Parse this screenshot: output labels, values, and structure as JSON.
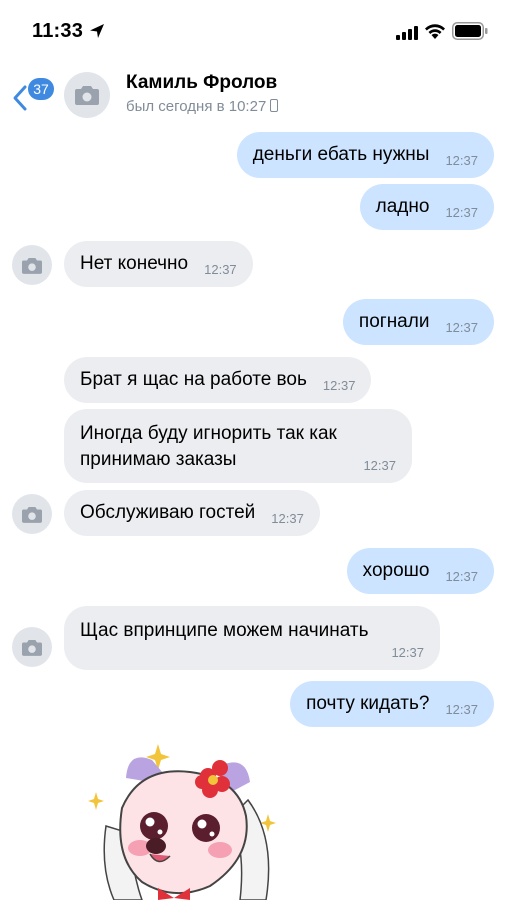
{
  "status_bar": {
    "time": "11:33",
    "icons": [
      "location-arrow-icon",
      "cellular-signal-icon",
      "wifi-icon",
      "battery-icon"
    ]
  },
  "header": {
    "back_badge": "37",
    "contact_name": "Камиль Фролов",
    "last_seen": "был сегодня в 10:27",
    "icons": [
      "back-arrow-icon",
      "camera-icon",
      "phone-icon"
    ]
  },
  "messages": [
    {
      "direction": "out",
      "text": "деньги ебать нужны",
      "time": "12:37"
    },
    {
      "direction": "out",
      "text": "ладно",
      "time": "12:37"
    },
    {
      "direction": "in",
      "text": "Нет конечно",
      "time": "12:37",
      "avatar": true
    },
    {
      "direction": "out",
      "text": "погнали",
      "time": "12:37"
    },
    {
      "direction": "in",
      "text": "Брат я щас на работе воь",
      "time": "12:37"
    },
    {
      "direction": "in",
      "text": "Иногда буду игнорить так как принимаю заказы",
      "time": "12:37"
    },
    {
      "direction": "in",
      "text": "Обслуживаю гостей",
      "time": "12:37",
      "avatar": true
    },
    {
      "direction": "out",
      "text": "хорошо",
      "time": "12:37"
    },
    {
      "direction": "in",
      "text": "Щас впринципе можем начинать",
      "time": "12:37",
      "avatar": true
    },
    {
      "direction": "out",
      "text": "почту кидать?",
      "time": "12:37"
    }
  ],
  "colors": {
    "outgoing_bubble": "#cce4ff",
    "incoming_bubble": "#ebedf0",
    "accent": "#3f8ae0",
    "secondary_text": "#818c99"
  }
}
